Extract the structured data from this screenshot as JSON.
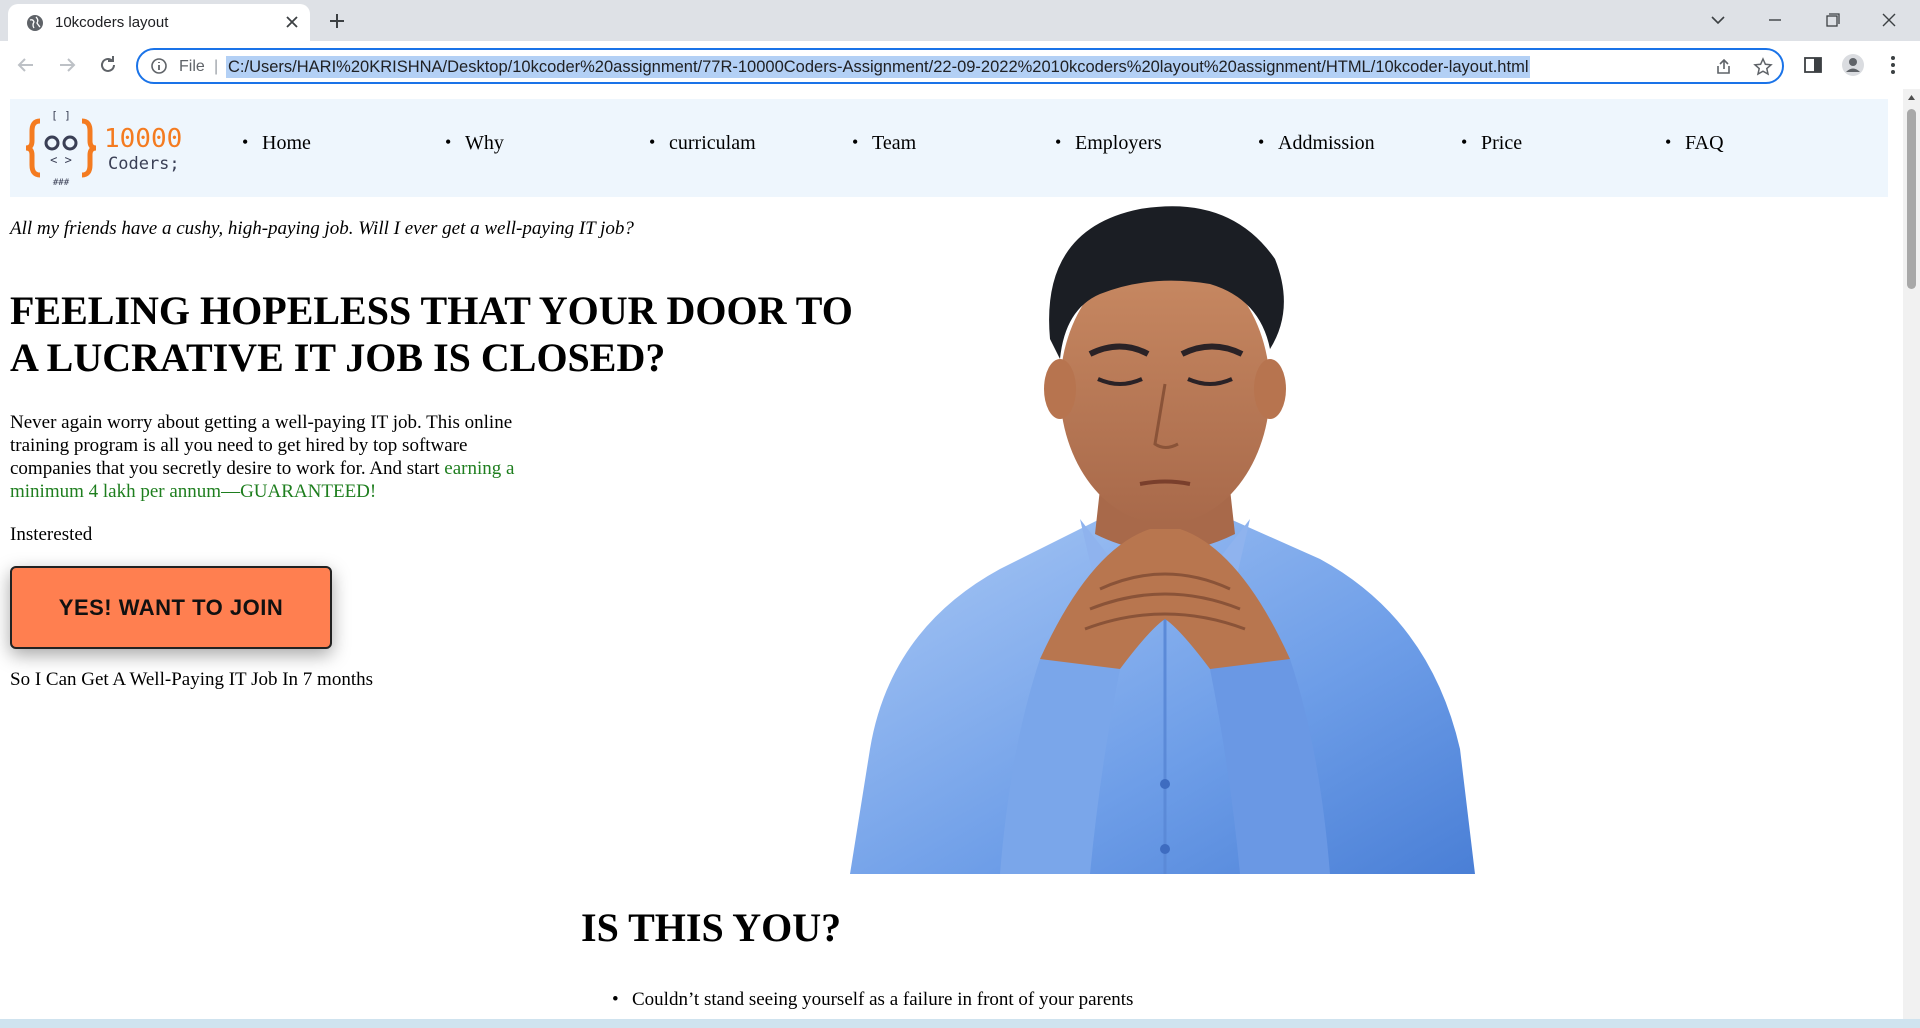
{
  "browser": {
    "tab_title": "10kcoders layout",
    "url_scheme": "File",
    "url": "C:/Users/HARI%20KRISHNA/Desktop/10kcoder%20assignment/77R-10000Coders-Assignment/22-09-2022%2010kcoders%20layout%20assignment/HTML/10kcoder-layout.html",
    "accent_color": "#1a73e8"
  },
  "site": {
    "logo": {
      "text_top": "10000",
      "text_bottom": "Coders;",
      "brand_color": "#f47b20"
    },
    "nav": [
      "Home",
      "Why",
      "curriculam",
      "Team",
      "Employers",
      "Addmission",
      "Price",
      "FAQ"
    ],
    "kicker": "All my friends have a cushy, high-paying job. Will I ever get a well-paying IT job?",
    "headline": "FEELING HOPELESS THAT YOUR DOOR TO A LUCRATIVE IT JOB IS CLOSED?",
    "paragraph_plain": "Never again worry about getting a well-paying IT job. This online training program is all you need to get hired by top software companies that you secretly desire to work for. And start ",
    "paragraph_highlight": "earning a minimum 4 lakh per annum—GUARANTEED!",
    "interested": "Insterested",
    "cta_label": "YES! WANT TO JOIN",
    "cta_color": "#ff7f50",
    "cta_sub": "So I Can Get A Well-Paying IT Job In 7 months",
    "section_title": "IS THIS YOU?",
    "bullets": [
      "Couldn’t stand seeing yourself as a failure in front of your parents"
    ]
  }
}
